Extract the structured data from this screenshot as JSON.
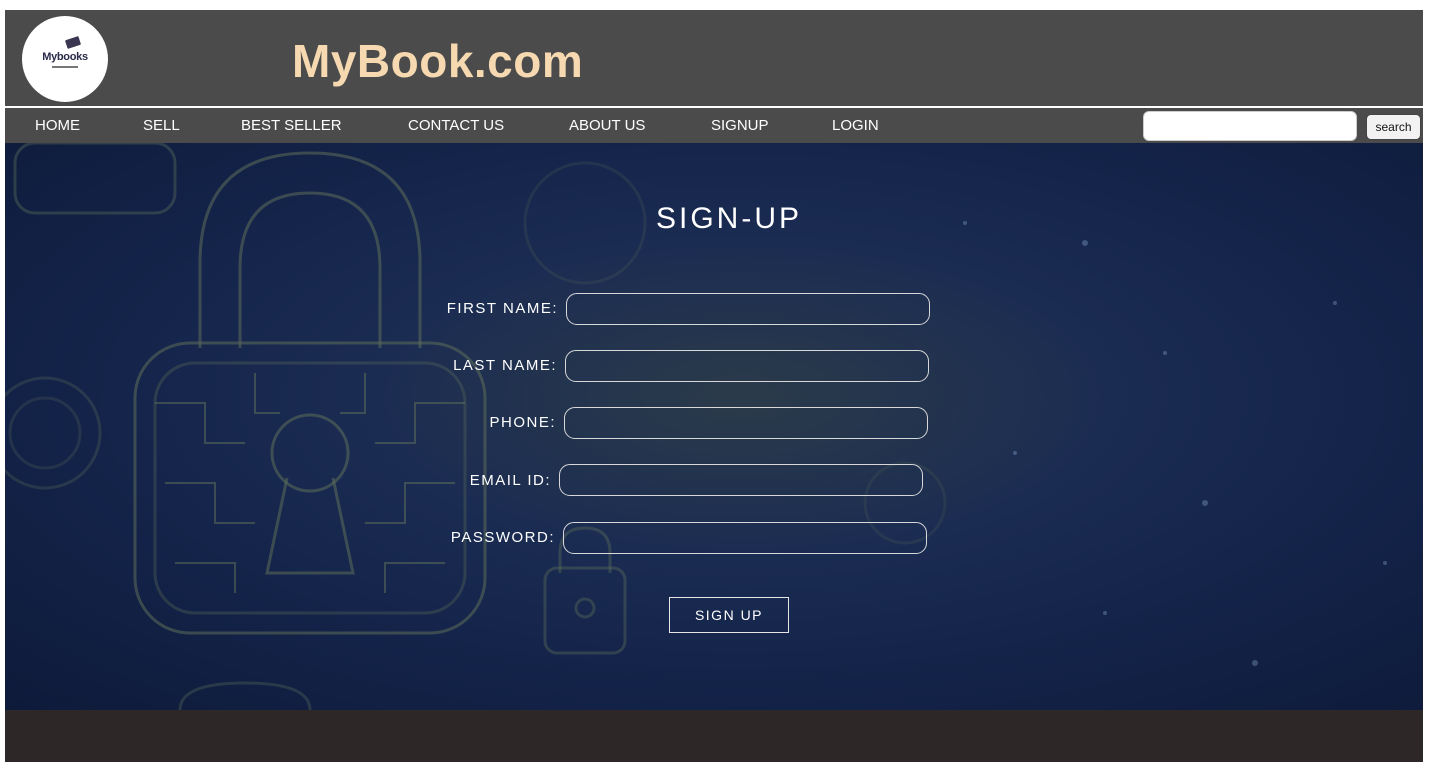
{
  "header": {
    "logo_text": "Mybooks",
    "site_title": "MyBook.com"
  },
  "nav": {
    "items": [
      {
        "label": "HOME"
      },
      {
        "label": "SELL"
      },
      {
        "label": "BEST SELLER"
      },
      {
        "label": "CONTACT US"
      },
      {
        "label": "ABOUT US"
      },
      {
        "label": "SIGNUP"
      },
      {
        "label": "LOGIN"
      }
    ],
    "search": {
      "value": "",
      "placeholder": "",
      "button_label": "search"
    }
  },
  "form": {
    "title": "SIGN-UP",
    "fields": [
      {
        "label": "FIRST NAME:",
        "value": ""
      },
      {
        "label": "LAST NAME:",
        "value": ""
      },
      {
        "label": "PHONE:",
        "value": ""
      },
      {
        "label": "EMAIL ID:",
        "value": ""
      },
      {
        "label": "PASSWORD:",
        "value": ""
      }
    ],
    "submit_label": "SIGN UP"
  },
  "colors": {
    "header_bg": "#4b4b4b",
    "title_color": "#f6d9b0",
    "hero_bg": "#14244a",
    "footer_bg": "#2e2727"
  },
  "icons": {
    "background": "padlock-circuit-icon"
  }
}
